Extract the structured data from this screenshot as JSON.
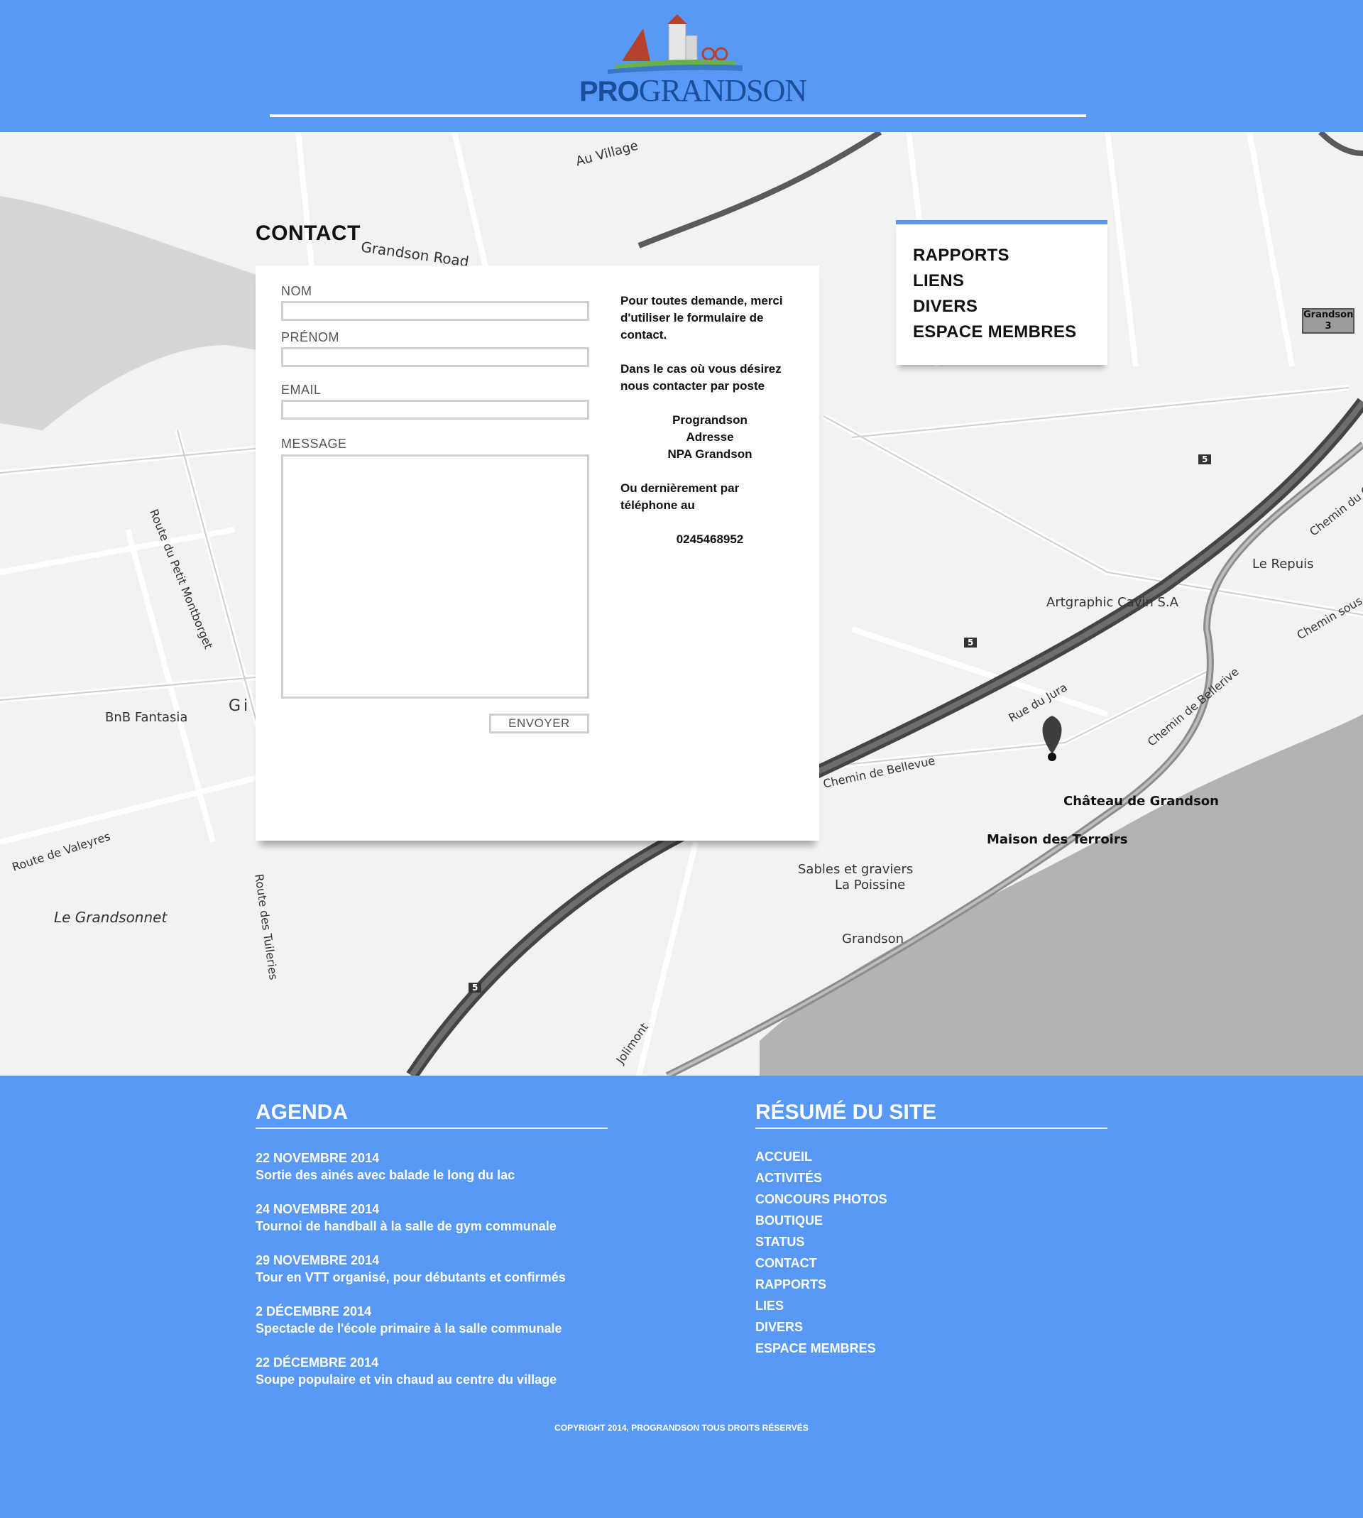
{
  "header": {
    "logo_bold": "PRO",
    "logo_rest": "GRANDSON"
  },
  "contact": {
    "title": "CONTACT",
    "fields": {
      "nom_label": "NOM",
      "prenom_label": "PRÉNOM",
      "email_label": "EMAIL",
      "message_label": "MESSAGE"
    },
    "submit_label": "ENVOYER",
    "info": {
      "intro": "Pour toutes demande, merci d'utiliser le formulaire de contact.",
      "post": "Dans le cas où vous désirez nous contacter par poste",
      "address_line1": "Prograndson",
      "address_line2": "Adresse",
      "address_line3": "NPA Grandson",
      "phone_intro": "Ou dernièrement par téléphone au",
      "phone": "0245468952"
    }
  },
  "side_menu": {
    "items": [
      "RAPPORTS",
      "LIENS",
      "DIVERS",
      "ESPACE MEMBRES"
    ]
  },
  "map": {
    "labels": {
      "au_village": "Au Village",
      "grandson_road": "Grandson Road",
      "route_petit_montborget": "Route du Petit Montborget",
      "bnb_fantasia": "BnB Fantasia",
      "gi": "Gi",
      "route_valeyres": "Route de Valeyres",
      "le_grandsonnet": "Le Grandsonnet",
      "route_tuileries": "Route des Tuileries",
      "le_repuis": "Le Repuis",
      "artgraphic": "Artgraphic Cavin S.A",
      "rue_du_jura": "Rue du Jura",
      "chemin_bellevue": "Chemin de Bellevue",
      "chemin_bellerive": "Chemin de Bellerive",
      "chemin_sous_le": "Chemin sous le",
      "chemin_du_c": "Chemin du C",
      "chateau": "Château de Grandson",
      "maison_terroirs": "Maison des Terroirs",
      "sables": "Sables et graviers",
      "la_poissine": "La Poissine",
      "grandson": "Grandson",
      "jolimont": "Jolimont",
      "exit_grandson": "Grandson",
      "exit_number": "3",
      "road_5": "5"
    }
  },
  "agenda": {
    "title": "AGENDA",
    "items": [
      {
        "date": "22 NOVEMBRE 2014",
        "text": "Sortie des ainés avec balade le long du lac"
      },
      {
        "date": "24 NOVEMBRE 2014",
        "text": "Tournoi de handball à la salle de gym communale"
      },
      {
        "date": "29 NOVEMBRE 2014",
        "text": "Tour en VTT organisé, pour débutants et confirmés"
      },
      {
        "date": "2 DÉCEMBRE 2014",
        "text": "Spectacle de l'école primaire à la salle communale"
      },
      {
        "date": "22 DÉCEMBRE 2014",
        "text": "Soupe populaire et vin chaud au centre du village"
      }
    ]
  },
  "site_summary": {
    "title": "RÉSUMÉ DU SITE",
    "links": [
      "ACCUEIL",
      "ACTIVITÉS",
      "CONCOURS PHOTOS",
      "BOUTIQUE",
      "STATUS",
      "CONTACT",
      "RAPPORTS",
      "LIES",
      "DIVERS",
      "ESPACE MEMBRES"
    ]
  },
  "copyright": "COPYRIGHT 2014, PROGRANDSON TOUS DROITS RÉSERVÉS",
  "colors": {
    "brand_blue": "#5899f8",
    "logo_blue": "#1a4e9a"
  }
}
